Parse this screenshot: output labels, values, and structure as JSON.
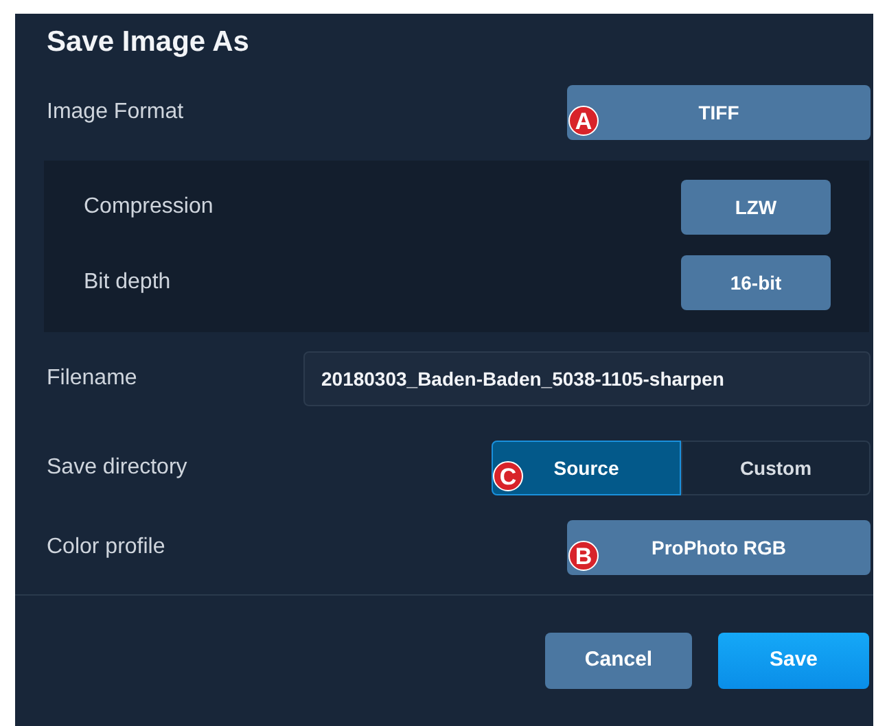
{
  "title": "Save Image As",
  "rows": [
    {
      "kind": "select",
      "label": "Image Format",
      "value": "TIFF",
      "callout": "A"
    },
    {
      "kind": "group",
      "children": [
        {
          "kind": "select",
          "label": "Compression",
          "value": "LZW"
        },
        {
          "kind": "select",
          "label": "Bit depth",
          "value": "16-bit"
        }
      ]
    },
    {
      "kind": "text",
      "label": "Filename",
      "value": "20180303_Baden-Baden_5038-1105-sharpen"
    },
    {
      "kind": "segmented",
      "label": "Save directory",
      "callout": "C",
      "options": [
        {
          "label": "Source",
          "selected": true
        },
        {
          "label": "Custom",
          "selected": false
        }
      ]
    },
    {
      "kind": "select",
      "label": "Color profile",
      "value": "ProPhoto RGB",
      "callout": "B"
    }
  ],
  "buttons": [
    {
      "label": "Cancel",
      "kind": "secondary"
    },
    {
      "label": "Save",
      "kind": "primary"
    }
  ]
}
